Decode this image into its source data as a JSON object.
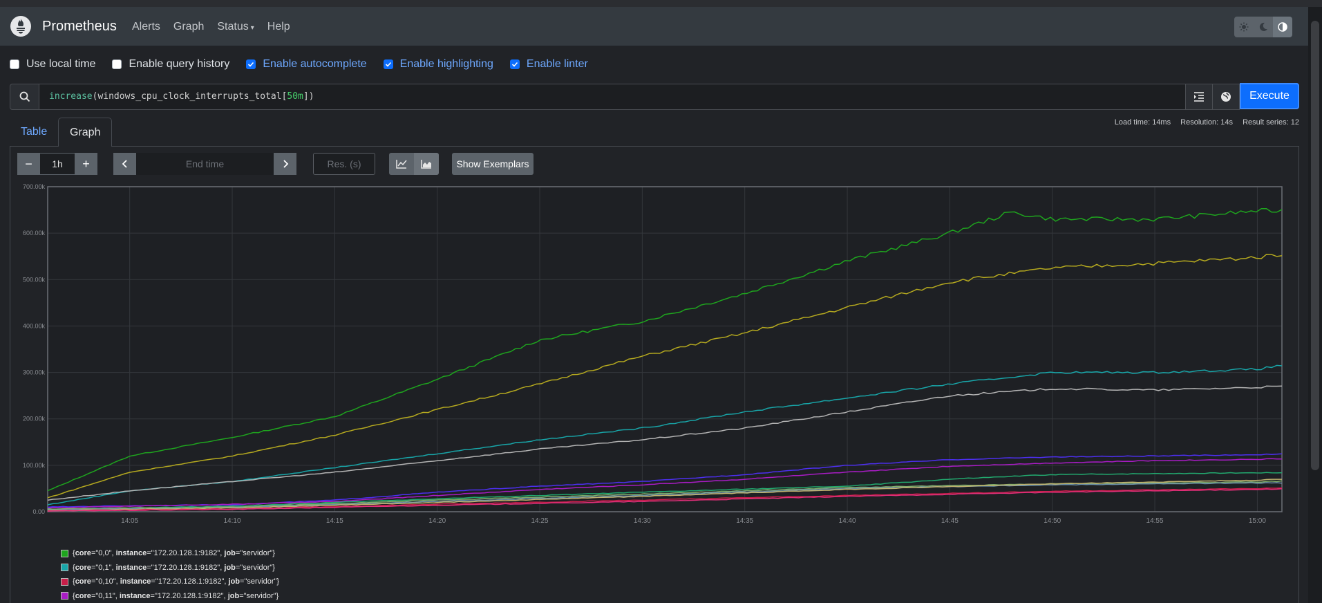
{
  "app": {
    "name": "Prometheus",
    "nav": [
      "Alerts",
      "Graph",
      "Status",
      "Help"
    ]
  },
  "options": [
    {
      "label": "Use local time",
      "checked": false
    },
    {
      "label": "Enable query history",
      "checked": false
    },
    {
      "label": "Enable autocomplete",
      "checked": true
    },
    {
      "label": "Enable highlighting",
      "checked": true
    },
    {
      "label": "Enable linter",
      "checked": true
    }
  ],
  "query": {
    "fn": "increase",
    "metric": "windows_cpu_clock_interrupts_total",
    "range": "50m",
    "execute_label": "Execute"
  },
  "tabs": {
    "table": "Table",
    "graph": "Graph"
  },
  "stats": {
    "load_time": "Load time: 14ms",
    "resolution": "Resolution: 14s",
    "result_series": "Result series: 12"
  },
  "controls": {
    "minus": "−",
    "plus": "+",
    "range": "1h",
    "end_time_placeholder": "End time",
    "res_placeholder": "Res. (s)",
    "show_exemplars": "Show Exemplars"
  },
  "chart_data": {
    "type": "line",
    "x_labels": [
      "14:05",
      "14:10",
      "14:15",
      "14:20",
      "14:25",
      "14:30",
      "14:35",
      "14:40",
      "14:45",
      "14:50",
      "14:55",
      "15:00"
    ],
    "y_labels": [
      "0.00",
      "100.00k",
      "200.00k",
      "300.00k",
      "400.00k",
      "500.00k",
      "600.00k",
      "700.00k"
    ],
    "y_range": [
      0,
      700000
    ],
    "x_range_minutes": [
      1,
      61.2
    ],
    "x_tick_minutes": [
      5,
      10,
      15,
      20,
      25,
      30,
      35,
      40,
      45,
      50,
      55,
      60
    ],
    "series": [
      {
        "color": "#1ea51e",
        "x": [
          1,
          5,
          10,
          15,
          20,
          25,
          30,
          35,
          40,
          45,
          48,
          50,
          55,
          60,
          61.2
        ],
        "y": [
          45000,
          120000,
          160000,
          205000,
          285000,
          370000,
          410000,
          470000,
          540000,
          600000,
          645000,
          630000,
          630000,
          648000,
          648000
        ]
      },
      {
        "color": "#b5a91f",
        "x": [
          1,
          5,
          10,
          15,
          20,
          25,
          30,
          35,
          40,
          45,
          50,
          55,
          60,
          61.2
        ],
        "y": [
          30000,
          85000,
          120000,
          165000,
          220000,
          275000,
          335000,
          385000,
          440000,
          495000,
          525000,
          535000,
          548000,
          555000
        ]
      },
      {
        "color": "#18a5a8",
        "x": [
          1,
          5,
          10,
          15,
          20,
          25,
          30,
          35,
          40,
          45,
          50,
          55,
          60,
          61.2
        ],
        "y": [
          15000,
          45000,
          65000,
          95000,
          125000,
          155000,
          180000,
          215000,
          245000,
          275000,
          300000,
          300000,
          307000,
          315000
        ]
      },
      {
        "color": "#b4b4b4",
        "x": [
          1,
          5,
          10,
          15,
          20,
          25,
          30,
          35,
          40,
          45,
          50,
          55,
          60,
          61.2
        ],
        "y": [
          25000,
          45000,
          65000,
          85000,
          110000,
          135000,
          155000,
          180000,
          215000,
          250000,
          265000,
          262000,
          268000,
          270000
        ]
      },
      {
        "color": "#4d2ff0",
        "x": [
          1,
          5,
          10,
          15,
          20,
          25,
          30,
          35,
          40,
          45,
          50,
          55,
          60,
          61.2
        ],
        "y": [
          10000,
          13000,
          15000,
          25000,
          42000,
          55000,
          65000,
          80000,
          100000,
          112000,
          118000,
          120000,
          123000,
          124000
        ]
      },
      {
        "color": "#a81cc4",
        "x": [
          1,
          5,
          10,
          15,
          20,
          25,
          30,
          35,
          40,
          45,
          50,
          55,
          60,
          61.2
        ],
        "y": [
          8000,
          12000,
          16000,
          22000,
          35000,
          48000,
          58000,
          70000,
          85000,
          98000,
          105000,
          110000,
          113000,
          114000
        ]
      },
      {
        "color": "#22a86e",
        "x": [
          1,
          10,
          20,
          30,
          40,
          45,
          50,
          55,
          60,
          61.2
        ],
        "y": [
          5000,
          12000,
          28000,
          42000,
          55000,
          70000,
          80000,
          82000,
          84000,
          84000
        ]
      },
      {
        "color": "#7fae6b",
        "x": [
          1,
          10,
          20,
          30,
          40,
          50,
          60,
          61.2
        ],
        "y": [
          6000,
          10000,
          25000,
          38000,
          52000,
          60000,
          64000,
          66000
        ]
      },
      {
        "color": "#6a8fa8",
        "x": [
          1,
          10,
          20,
          30,
          40,
          50,
          60,
          61.2
        ],
        "y": [
          4000,
          9000,
          22000,
          35000,
          50000,
          58000,
          62000,
          62000
        ]
      },
      {
        "color": "#c0b26e",
        "x": [
          1,
          10,
          20,
          30,
          40,
          50,
          60,
          61.2
        ],
        "y": [
          3000,
          8000,
          20000,
          33000,
          48000,
          60000,
          68000,
          70000
        ]
      },
      {
        "color": "#c81e49",
        "x": [
          1,
          10,
          20,
          30,
          40,
          50,
          60,
          61.2
        ],
        "y": [
          2000,
          6000,
          16000,
          25000,
          35000,
          44000,
          50000,
          51000
        ]
      },
      {
        "color": "#e02f7a",
        "x": [
          1,
          10,
          20,
          30,
          40,
          50,
          60,
          61.2
        ],
        "y": [
          1500,
          5000,
          14000,
          22000,
          33000,
          42000,
          48000,
          49000
        ]
      }
    ]
  },
  "legend": [
    {
      "color": "#1ea51e",
      "core": "0,0",
      "instance": "172.20.128.1:9182",
      "job": "servidor"
    },
    {
      "color": "#18a5a8",
      "core": "0,1",
      "instance": "172.20.128.1:9182",
      "job": "servidor"
    },
    {
      "color": "#c81e49",
      "core": "0,10",
      "instance": "172.20.128.1:9182",
      "job": "servidor"
    },
    {
      "color": "#a81cc4",
      "core": "0,11",
      "instance": "172.20.128.1:9182",
      "job": "servidor"
    }
  ]
}
